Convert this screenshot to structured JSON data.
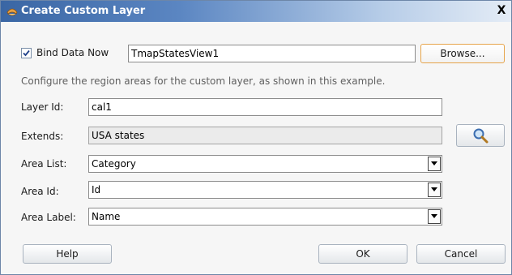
{
  "window": {
    "title": "Create Custom Layer",
    "close_glyph": "X"
  },
  "bind": {
    "checked": true,
    "label": "Bind Data Now",
    "value": "TmapStatesView1",
    "browse_label": "Browse..."
  },
  "hint": "Configure the region areas for the custom layer, as shown in this example.",
  "form": {
    "layer_id": {
      "label": "Layer Id:",
      "value": "cal1"
    },
    "extends": {
      "label": "Extends:",
      "value": "USA states"
    },
    "area_list": {
      "label": "Area List:",
      "value": "Category"
    },
    "area_id": {
      "label": "Area Id:",
      "value": "Id"
    },
    "area_label": {
      "label": "Area Label:",
      "value": "Name"
    }
  },
  "footer": {
    "help_label": "Help",
    "ok_label": "OK",
    "cancel_label": "Cancel"
  },
  "icons": {
    "title": "dialog-app-icon",
    "search": "magnifier-icon",
    "dropdown": "chevron-down-icon"
  },
  "colors": {
    "title_bar": "#3a66a4",
    "focus_border": "#e6a44a"
  }
}
